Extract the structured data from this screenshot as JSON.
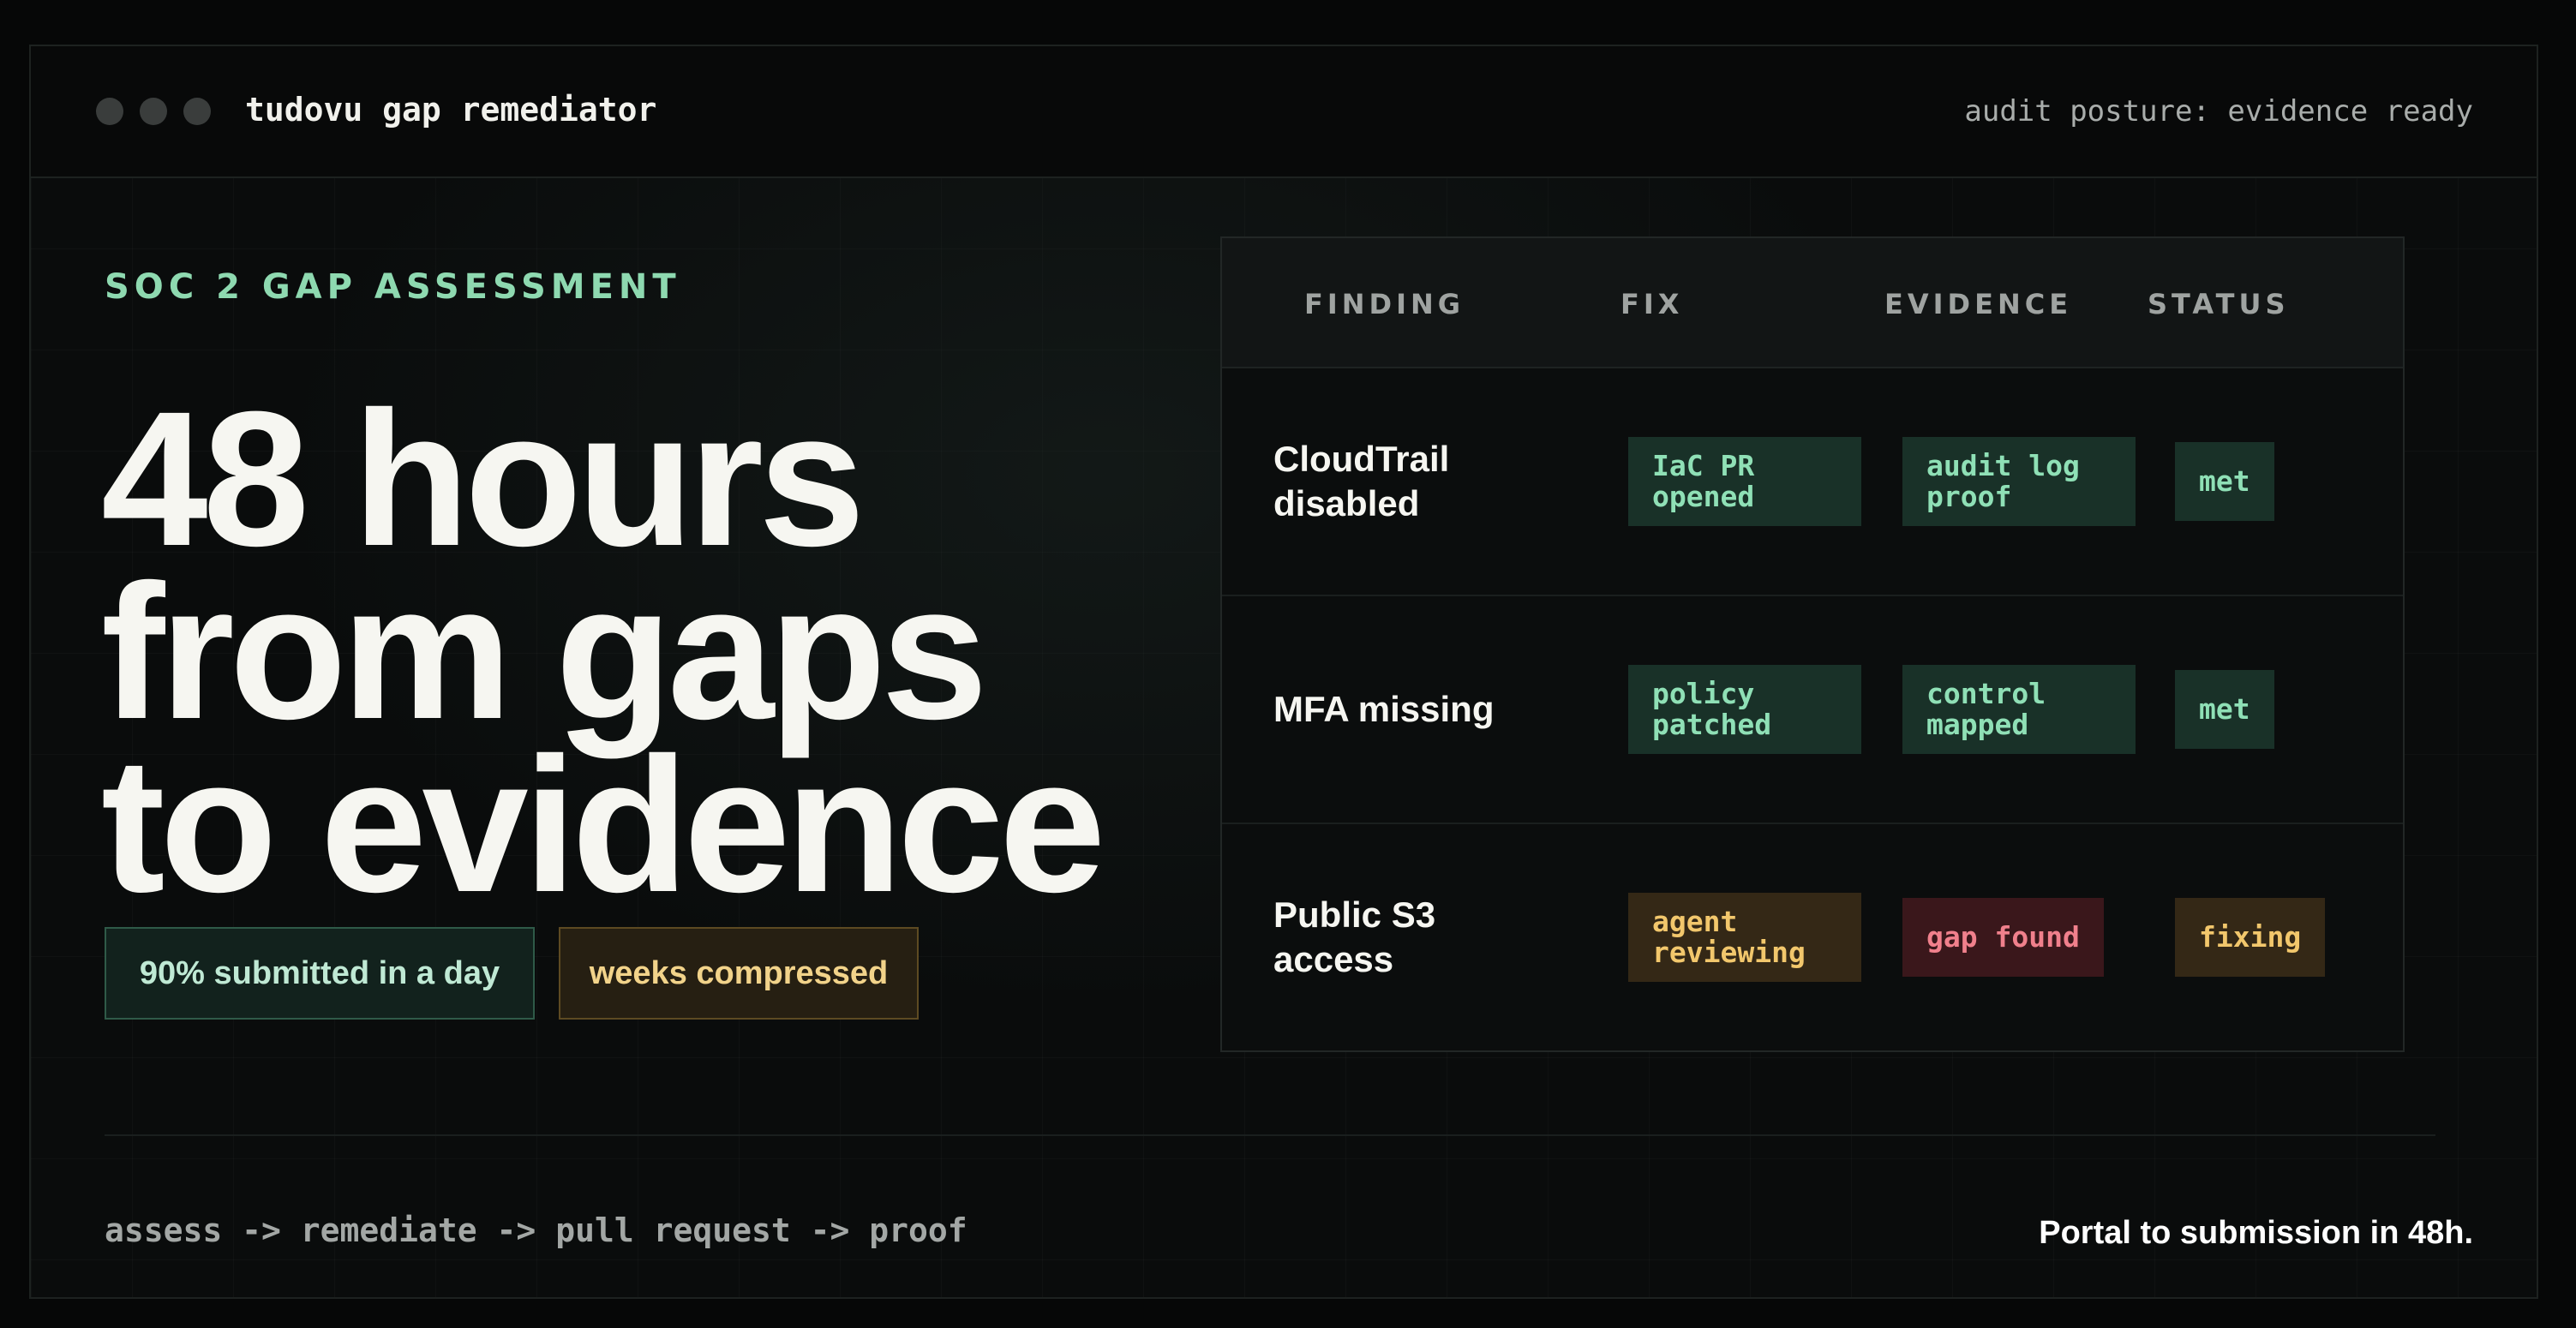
{
  "window": {
    "title": "tudovu gap remediator",
    "status": "audit posture: evidence ready"
  },
  "hero": {
    "eyebrow": "SOC 2 GAP ASSESSMENT",
    "headline": [
      "48 hours",
      "from gaps",
      "to evidence"
    ],
    "badges": [
      "90% submitted in a day",
      "weeks compressed"
    ]
  },
  "table": {
    "columns": [
      "FINDING",
      "FIX",
      "EVIDENCE",
      "STATUS"
    ],
    "rows": [
      {
        "finding": "CloudTrail disabled",
        "fix": "IaC PR opened",
        "evidence": "audit log proof",
        "status": "met"
      },
      {
        "finding": "MFA missing",
        "fix": "policy patched",
        "evidence": "control mapped",
        "status": "met"
      },
      {
        "finding": "Public S3 access",
        "fix": "agent reviewing",
        "evidence": "gap found",
        "status": "fixing"
      }
    ]
  },
  "footer": {
    "flow": "assess -> remediate -> pull request -> proof",
    "tagline": "Portal to submission in 48h."
  },
  "colors": {
    "accent_green": "#8ed9b0",
    "accent_amber": "#f2c76c",
    "accent_red": "#f0808c",
    "background": "#0a0c0c"
  }
}
